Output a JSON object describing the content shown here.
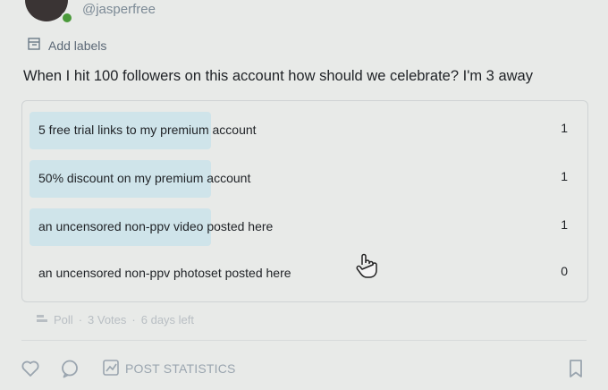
{
  "post": {
    "handle": "@jasperfree",
    "add_labels": "Add labels",
    "question": "When I hit 100 followers on this account how should we celebrate? I'm 3 away"
  },
  "poll": {
    "options": [
      {
        "label": "5 free trial links to my premium account",
        "votes": "1",
        "fraction": 0.33
      },
      {
        "label": "50% discount on my premium account",
        "votes": "1",
        "fraction": 0.33
      },
      {
        "label": "an uncensored non-ppv video posted here",
        "votes": "1",
        "fraction": 0.33
      },
      {
        "label": "an uncensored non-ppv photoset posted here",
        "votes": "0",
        "fraction": 0
      }
    ],
    "meta": {
      "type": "Poll",
      "votes": "3 Votes",
      "time_left": "6 days left",
      "sep": "·"
    }
  },
  "actions": {
    "post_statistics": "POST STATISTICS"
  },
  "icons": {
    "label": "tag-icon",
    "like": "heart-icon",
    "comment": "comment-icon",
    "stats": "chart-icon",
    "bookmark": "bookmark-icon",
    "poll": "poll-icon",
    "cursor": "hand-pointer-icon"
  },
  "colors": {
    "accent_fill": "#cfe4ea",
    "muted": "#9aa5af",
    "online": "#4a9a3a"
  }
}
